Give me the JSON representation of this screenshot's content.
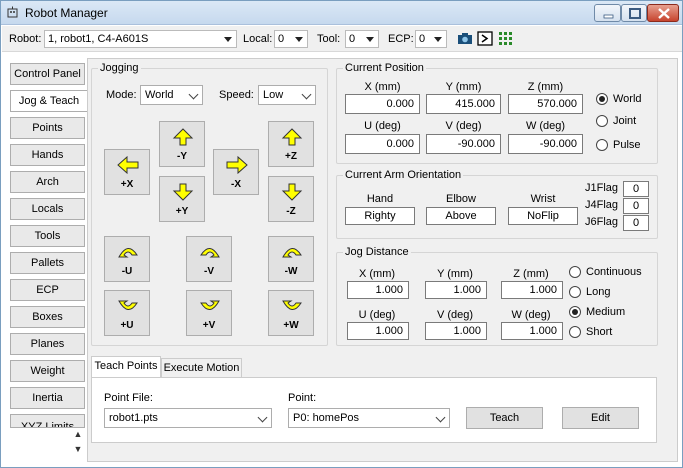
{
  "window": {
    "title": "Robot Manager",
    "icon": "robot-icon"
  },
  "toolbar": {
    "robot_label": "Robot:",
    "robot_value": "1, robot1, C4-A601S",
    "local_label": "Local:",
    "local_value": "0",
    "tool_label": "Tool:",
    "tool_value": "0",
    "ecp_label": "ECP:",
    "ecp_value": "0",
    "icons": [
      "camera-icon",
      "command-window-icon",
      "io-monitor-icon"
    ]
  },
  "nav": {
    "items": [
      "Control Panel",
      "Jog & Teach",
      "Points",
      "Hands",
      "Arch",
      "Locals",
      "Tools",
      "Pallets",
      "ECP",
      "Boxes",
      "Planes",
      "Weight",
      "Inertia",
      "XYZ Limits"
    ],
    "active": "Jog & Teach"
  },
  "jogging": {
    "title": "Jogging",
    "mode_label": "Mode:",
    "mode_value": "World",
    "speed_label": "Speed:",
    "speed_value": "Low",
    "buttons": {
      "yminus": "-Y",
      "zplus": "+Z",
      "xplus": "+X",
      "xminus": "-X",
      "yplus": "+Y",
      "zminus": "-Z",
      "uminus": "-U",
      "vminus": "-V",
      "wminus": "-W",
      "uplus": "+U",
      "vplus": "+V",
      "wplus": "+W"
    }
  },
  "current_position": {
    "title": "Current Position",
    "x_label": "X (mm)",
    "x_value": "0.000",
    "y_label": "Y (mm)",
    "y_value": "415.000",
    "z_label": "Z (mm)",
    "z_value": "570.000",
    "u_label": "U (deg)",
    "u_value": "0.000",
    "v_label": "V (deg)",
    "v_value": "-90.000",
    "w_label": "W (deg)",
    "w_value": "-90.000",
    "modes": [
      "World",
      "Joint",
      "Pulse"
    ],
    "selected_mode": "World"
  },
  "arm_orientation": {
    "title": "Current Arm Orientation",
    "hand_label": "Hand",
    "hand_value": "Righty",
    "elbow_label": "Elbow",
    "elbow_value": "Above",
    "wrist_label": "Wrist",
    "wrist_value": "NoFlip",
    "j1_label": "J1Flag",
    "j1_value": "0",
    "j4_label": "J4Flag",
    "j4_value": "0",
    "j6_label": "J6Flag",
    "j6_value": "0"
  },
  "jog_distance": {
    "title": "Jog Distance",
    "x_label": "X (mm)",
    "x_value": "1.000",
    "y_label": "Y (mm)",
    "y_value": "1.000",
    "z_label": "Z (mm)",
    "z_value": "1.000",
    "u_label": "U (deg)",
    "u_value": "1.000",
    "v_label": "V (deg)",
    "v_value": "1.000",
    "w_label": "W (deg)",
    "w_value": "1.000",
    "options": [
      "Continuous",
      "Long",
      "Medium",
      "Short"
    ],
    "selected": "Medium"
  },
  "bottom_tabs": {
    "tabs": [
      "Teach Points",
      "Execute Motion"
    ],
    "active": "Teach Points",
    "point_file_label": "Point File:",
    "point_file_value": "robot1.pts",
    "point_label": "Point:",
    "point_value": "P0: homePos",
    "teach_label": "Teach",
    "edit_label": "Edit"
  },
  "colors": {
    "arrow_fill": "#ffff00",
    "titlebar": "#c6d9ee",
    "close_button": "#c7442e"
  }
}
